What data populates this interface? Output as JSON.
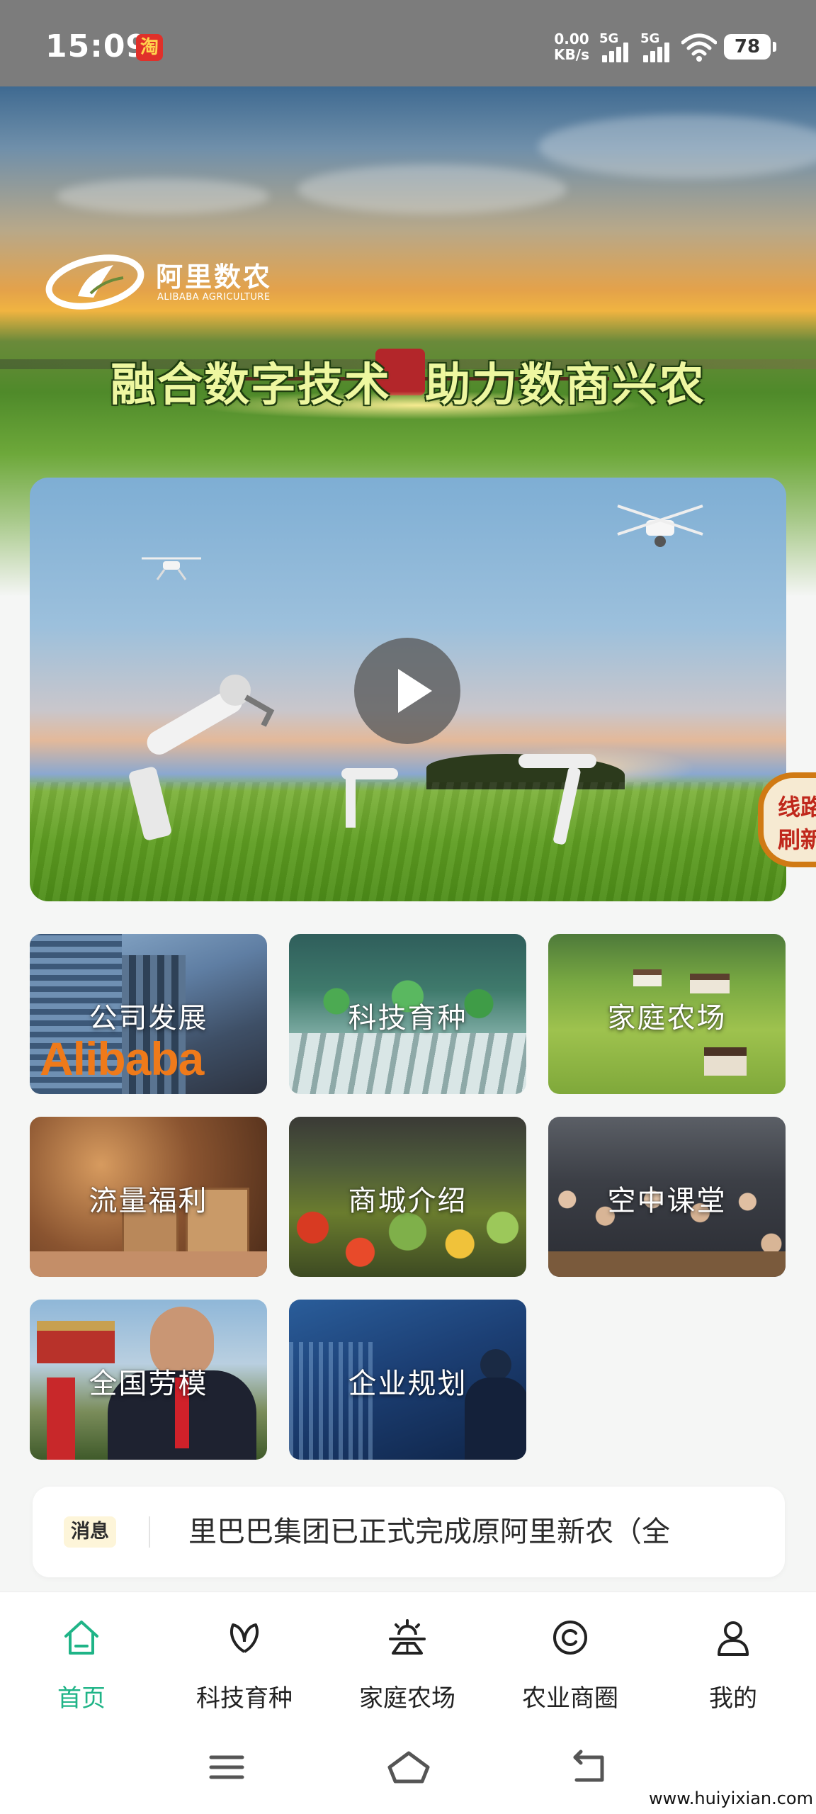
{
  "status_bar": {
    "time": "15:09",
    "net_speed_value": "0.00",
    "net_speed_unit": "KB/s",
    "sim1_label": "5G",
    "sim2_label": "5G",
    "battery": "78",
    "taobao_glyph": "淘"
  },
  "banner": {
    "brand_cn": "阿里数农",
    "brand_en": "ALIBABA AGRICULTURE",
    "slogan_part1": "融合数字技术",
    "slogan_part2": "助力数商兴农"
  },
  "float_badge": {
    "line1": "线路",
    "line2": "刷新"
  },
  "grid": {
    "items": [
      {
        "label": "公司发展",
        "icon": "building-image"
      },
      {
        "label": "科技育种",
        "icon": "seedling-lab-image"
      },
      {
        "label": "家庭农场",
        "icon": "farm-image"
      },
      {
        "label": "流量福利",
        "icon": "gift-image"
      },
      {
        "label": "商城介绍",
        "icon": "produce-market-image"
      },
      {
        "label": "空中课堂",
        "icon": "classroom-image"
      },
      {
        "label": "全国劳模",
        "icon": "model-worker-image"
      },
      {
        "label": "企业规划",
        "icon": "city-planning-image"
      }
    ],
    "alibaba_sign": "Alibaba"
  },
  "news": {
    "tag": "消息",
    "text": "里巴巴集团已正式完成原阿里新农（全"
  },
  "bottom_nav": {
    "items": [
      {
        "label": "首页",
        "icon": "home-icon",
        "active": true
      },
      {
        "label": "科技育种",
        "icon": "leaf-icon",
        "active": false
      },
      {
        "label": "家庭农场",
        "icon": "farm-sun-icon",
        "active": false
      },
      {
        "label": "农业商圈",
        "icon": "circle-icon",
        "active": false
      },
      {
        "label": "我的",
        "icon": "user-icon",
        "active": false
      }
    ],
    "active_color": "#1fb487"
  },
  "system_nav": {
    "buttons": [
      "menu-icon",
      "home-outline-icon",
      "back-icon"
    ]
  },
  "watermark": "www.huiyixian.com"
}
